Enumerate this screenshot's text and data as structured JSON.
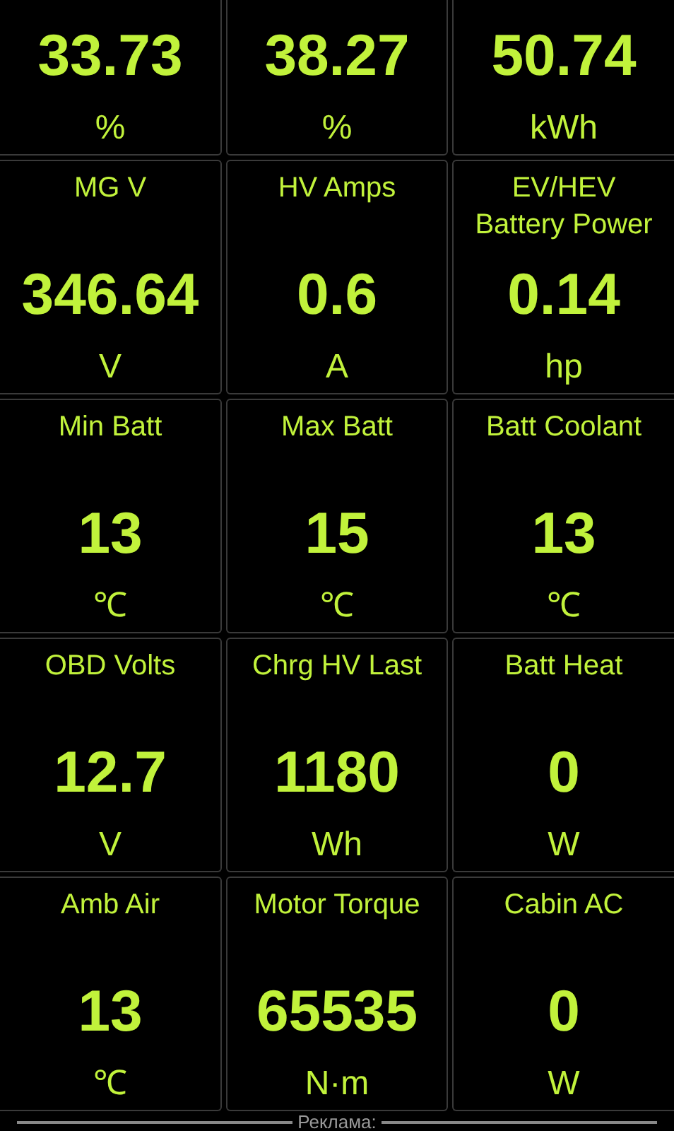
{
  "gauges": [
    {
      "value": "33.73",
      "unit": "%"
    },
    {
      "value": "38.27",
      "unit": "%"
    },
    {
      "value": "50.74",
      "unit": "kWh"
    },
    {
      "title": "MG V",
      "value": "346.64",
      "unit": "V"
    },
    {
      "title": "HV Amps",
      "value": "0.6",
      "unit": "A"
    },
    {
      "title": "EV/HEV Battery Power",
      "value": "0.14",
      "unit": "hp"
    },
    {
      "title": "Min Batt",
      "value": "13",
      "unit": "℃"
    },
    {
      "title": "Max Batt",
      "value": "15",
      "unit": "℃"
    },
    {
      "title": "Batt Coolant",
      "value": "13",
      "unit": "℃"
    },
    {
      "title": "OBD Volts",
      "value": "12.7",
      "unit": "V"
    },
    {
      "title": "Chrg HV Last",
      "value": "1180",
      "unit": "Wh"
    },
    {
      "title": "Batt Heat",
      "value": "0",
      "unit": "W"
    },
    {
      "title": "Amb Air",
      "value": "13",
      "unit": "℃"
    },
    {
      "title": "Motor Torque",
      "value": "65535",
      "unit": "N·m"
    },
    {
      "title": "Cabin AC",
      "value": "0",
      "unit": "W"
    }
  ],
  "ad_label": "Реклама:"
}
